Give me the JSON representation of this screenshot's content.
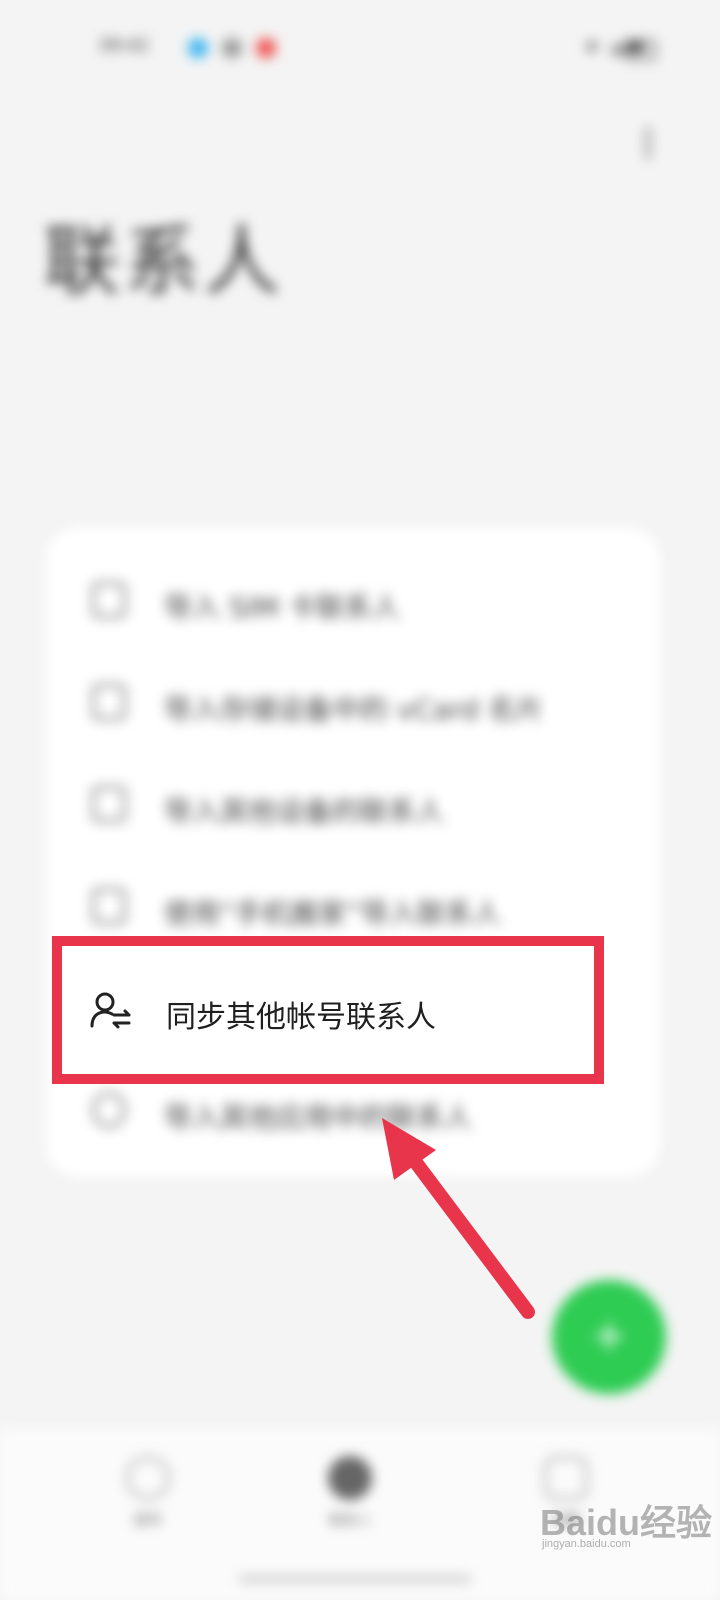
{
  "status_bar": {
    "time": "09:42",
    "notification_colors": [
      "#3bb6f0",
      "#9a9a9a",
      "#ef5350"
    ],
    "icons": [
      "bluetooth-icon",
      "signal-icon",
      "wifi-icon",
      "battery-icon"
    ]
  },
  "header": {
    "title": "联系人",
    "more_icon": "more-vertical-icon"
  },
  "menu": {
    "items": [
      {
        "label": "导入 SIM 卡联系人",
        "icon": "sim-card-icon"
      },
      {
        "label": "导入存储设备中的 vCard 名片",
        "icon": "folder-icon"
      },
      {
        "label": "导入其他设备的联系人",
        "icon": "device-import-icon"
      },
      {
        "label": "使用“手机搬家”导入联系人",
        "icon": "phone-clone-icon"
      },
      {
        "label": "同步其他帐号联系人",
        "icon": "account-sync-icon"
      },
      {
        "label": "导入其他应用中的联系人",
        "icon": "app-import-icon"
      }
    ]
  },
  "highlight": {
    "color": "#e8354c",
    "target": "同步其他帐号联系人"
  },
  "fab": {
    "icon": "add-contact-icon",
    "color": "#2ecc53"
  },
  "bottom_nav": {
    "tabs": [
      {
        "label": "拨号",
        "icon": "phone-icon"
      },
      {
        "label": "联系人",
        "icon": "contacts-icon"
      },
      {
        "label": "收藏",
        "icon": "star-icon"
      }
    ]
  },
  "watermark": {
    "logo": "Baidu经验",
    "url": "jingyan.baidu.com"
  }
}
